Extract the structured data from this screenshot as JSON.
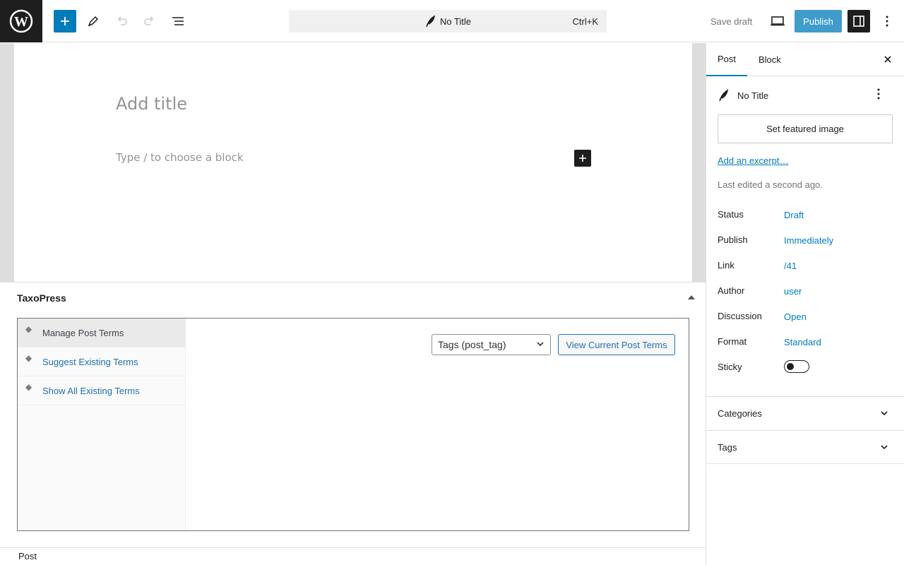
{
  "topbar": {
    "command_title": "No Title",
    "command_shortcut": "Ctrl+K",
    "save_draft": "Save draft",
    "publish": "Publish"
  },
  "editor": {
    "title_placeholder": "Add title",
    "block_placeholder": "Type / to choose a block"
  },
  "metabox": {
    "title": "TaxoPress",
    "tabs": [
      "Manage Post Terms",
      "Suggest Existing Terms",
      "Show All Existing Terms"
    ],
    "taxonomy_select": "Tags (post_tag)",
    "view_button": "View Current Post Terms"
  },
  "footer": {
    "breadcrumb": "Post"
  },
  "sidebar": {
    "tabs": [
      "Post",
      "Block"
    ],
    "post_title": "No Title",
    "featured_image": "Set featured image",
    "excerpt": "Add an excerpt…",
    "last_edited": "Last edited a second ago.",
    "rows": [
      {
        "label": "Status",
        "value": "Draft"
      },
      {
        "label": "Publish",
        "value": "Immediately"
      },
      {
        "label": "Link",
        "value": "/41"
      },
      {
        "label": "Author",
        "value": "user"
      },
      {
        "label": "Discussion",
        "value": "Open"
      },
      {
        "label": "Format",
        "value": "Standard"
      }
    ],
    "sticky_label": "Sticky",
    "sticky_on": false,
    "panels": [
      "Categories",
      "Tags"
    ]
  },
  "colors": {
    "accent": "#007cba",
    "dark": "#1e1e1e",
    "link": "#2271b1"
  },
  "icons": [
    "wordpress-logo-icon",
    "plus-icon",
    "pen-icon",
    "undo-icon",
    "redo-icon",
    "list-view-icon",
    "feather-icon",
    "desktop-preview-icon",
    "sidebar-icon",
    "more-vertical-icon",
    "close-icon",
    "tag-icon",
    "chevron-down-icon"
  ]
}
